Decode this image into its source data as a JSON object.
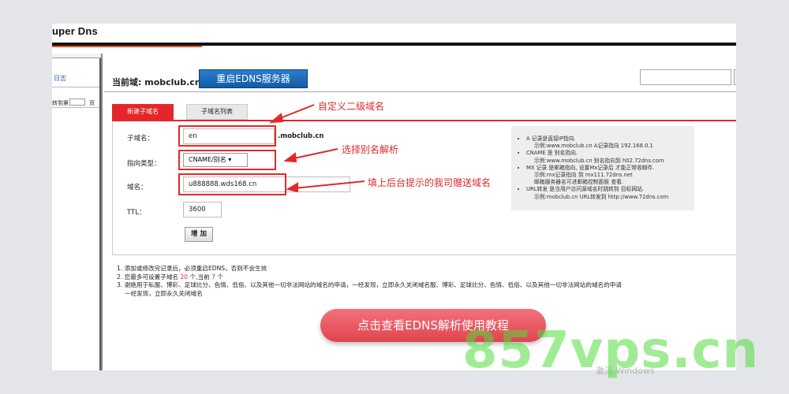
{
  "app": {
    "brand": "uper Dns"
  },
  "sidebar": {
    "log_link": "日志",
    "jump_label": "转到第",
    "page_unit": "页"
  },
  "header": {
    "current_domain": "当前域: mobclub.cn",
    "restart_button": "重启EDNS服务器"
  },
  "tabs": [
    {
      "label": "新建子域名",
      "active": true
    },
    {
      "label": "子域名列表",
      "active": false
    }
  ],
  "form": {
    "subdomain_label": "子域名：",
    "subdomain_value": "en",
    "domain_suffix": ".mobclub.cn",
    "type_label": "指向类型：",
    "type_value": "CNAME/别名 ▾",
    "domain_label": "域名：",
    "domain_value": "u888888.wds168.cn",
    "ttl_label": "TTL：",
    "ttl_value": "3600",
    "add_button": "增 加"
  },
  "annotations": {
    "a1": "自定义二级域名",
    "a2": "选择别名解析",
    "a3": "填上后台提示的我司赠送域名"
  },
  "help": {
    "items": [
      {
        "line": "A 记录是直接IP指向.",
        "example": "示例:www.mobclub.cn A记录指向 192.168.0.1"
      },
      {
        "line": "CNAME 是 别名指向.",
        "example": "示例:www.mobclub.cn 别名指向到 h02.72dns.com"
      },
      {
        "line": "MX 记录 是邮箱指向, 设置Mx记录后 才能正常收邮件.",
        "example": "示例:mx记录指向 到 mx111.72dns.net",
        "extra": "邮箱服务器名可进邮箱控制面板 查看."
      },
      {
        "line": "URL转发 是当用户访问源域名时跳转到 目标网站.",
        "example": "示例:mobclub.cn URL转发到 http://www.72dns.com"
      }
    ]
  },
  "notes": {
    "n1": "1. 添加或修改完记录后，必须重启EDNS，否则不会生效",
    "n2_prefix": "2. 您最多可设置子域名 ",
    "n2_max": "20",
    "n2_mid": " 个,当前 ",
    "n2_cur": "7",
    "n2_suffix": " 个",
    "n3": "3. 谢绝用于私服、博彩、足球比分、色情、低俗、以及其他一切非法网站的域名的申请，一经发现，立即永久关闭域名服、博彩、足球比分、色情、低俗、以及其他一切非法网站的域名的申请",
    "n3_cont": "一经发现，立即永久关闭域名"
  },
  "cta": {
    "label": "点击查看EDNS解析使用教程"
  },
  "watermarks": {
    "windows": "激活 Windows",
    "site": "857vps.cn"
  },
  "colors": {
    "accent_red": "#e4262a",
    "button_blue": "#1a6fbf",
    "watermark_green": "#50dc3c"
  }
}
